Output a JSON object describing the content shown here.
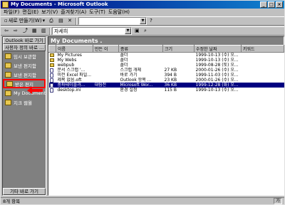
{
  "window": {
    "title": "My Documents - Microsoft Outlook"
  },
  "menu": [
    "파일(F)",
    "편집(E)",
    "보기(V)",
    "즐겨찾기(A)",
    "도구(T)",
    "도움말(H)"
  ],
  "toolbar": {
    "new_label": "새로 만들기(W)",
    "view_combo": "자세히"
  },
  "outlook_bar": {
    "header": "Outlook 바로 가기",
    "group": "사용자 정의 바로 ...",
    "items": [
      {
        "label": "임시 보관함",
        "icon": "drafts-folder-icon"
      },
      {
        "label": "보낸 편지함",
        "icon": "sent-folder-icon"
      },
      {
        "label": "보낸 편지함",
        "icon": "outbox-folder-icon"
      },
      {
        "label": "받은 편지",
        "icon": "inbox-folder-icon",
        "selected": true
      },
      {
        "label": "My Documents",
        "icon": "documents-folder-icon"
      },
      {
        "label": "지크 웹월",
        "icon": "web-folder-icon"
      }
    ],
    "footer": "기타 바로 가기"
  },
  "content": {
    "folder_title": "My Documents .",
    "columns": [
      "",
      "이름",
      "만든 이",
      "종류",
      "크기",
      "수정한 날짜",
      "키워드"
    ],
    "rows": [
      {
        "icon": "folder",
        "name": "My Pictures",
        "author": "",
        "type": "폴더",
        "size": "",
        "modified": "1999-10-13 (수) 오...",
        "selected": false
      },
      {
        "icon": "folder",
        "name": "My Webs",
        "author": "",
        "type": "폴더",
        "size": "",
        "modified": "1999-10-13 (수) 오...",
        "selected": false
      },
      {
        "icon": "folder",
        "name": "webpub",
        "author": "",
        "type": "폴더",
        "size": "",
        "modified": "1999-08-28 (토) 오...",
        "selected": false
      },
      {
        "icon": "doc",
        "name": "문서 스크랩 '...",
        "author": "",
        "type": "스크랩 개체",
        "size": "27 KB",
        "modified": "2000-01-26 (수) 오...",
        "selected": false
      },
      {
        "icon": "doc",
        "name": "미전 Excel 파일...",
        "author": "",
        "type": "바로 가기",
        "size": "394 B",
        "modified": "1999-11-03 (수) 오...",
        "selected": false
      },
      {
        "icon": "doc",
        "name": "제목 없음.oft",
        "author": "",
        "type": "Outlook 항목 ...",
        "size": "23 KB",
        "modified": "2000-01-26 (수) 오...",
        "selected": false
      },
      {
        "icon": "doc",
        "name": "중파테이블과...",
        "author": "대림전",
        "type": "Microsoft Wor...",
        "size": "36 KB",
        "modified": "1999-12-28 (화) 오...",
        "selected": true
      },
      {
        "icon": "doc",
        "name": "desktop.ini",
        "author": "",
        "type": "환경 설정",
        "size": "115 B",
        "modified": "1999-10-13 (수) 오...",
        "selected": false
      }
    ]
  },
  "status": {
    "left": "8개 항목",
    "right": "가"
  }
}
